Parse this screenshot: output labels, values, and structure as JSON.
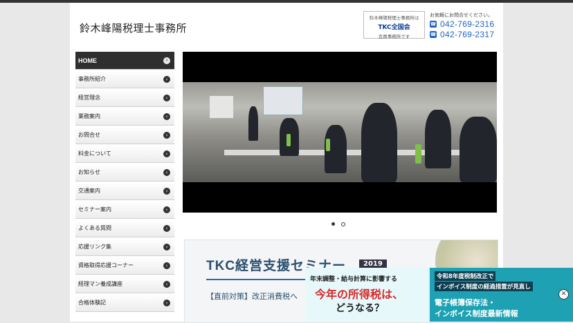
{
  "header": {
    "site_title": "鈴木峰陽税理士事務所",
    "tkc": {
      "line1": "鈴木峰陽税理士事務所は",
      "logo_text": "TKC全国会",
      "line3": "会員事務所です"
    },
    "contact": {
      "lead": "お気軽にお問合せください。",
      "tel1": "042-769-2316",
      "tel2": "042-769-2317"
    }
  },
  "nav": {
    "items": [
      {
        "label": "HOME"
      },
      {
        "label": "事務所紹介"
      },
      {
        "label": "経営理念"
      },
      {
        "label": "業務案内"
      },
      {
        "label": "お問合せ"
      },
      {
        "label": "料金について"
      },
      {
        "label": "お知らせ"
      },
      {
        "label": "交通案内"
      },
      {
        "label": "セミナー案内"
      },
      {
        "label": "よくある質問"
      },
      {
        "label": "応援リンク集"
      },
      {
        "label": "資格取得応援コーナー"
      },
      {
        "label": "経理マン養成講座"
      },
      {
        "label": "合格体験記"
      }
    ]
  },
  "banner": {
    "title": "TKC経営支援セミナー",
    "year": "2019",
    "subtitle": "【直前対策】改正消費税へ"
  },
  "ad": {
    "left_line1": "年末調整・給与計算に影響する",
    "left_line2": "今年の所得税は、",
    "left_line3": "どうなる？",
    "right_line1": "令和8年度税制改正で",
    "right_line2": "インボイス制度の経過措置が見直し",
    "right_line3": "電子帳簿保存法・",
    "right_line4": "インボイス制度最新情報",
    "close_label": "✕"
  },
  "colors": {
    "accent": "#1d63c3",
    "nav_active": "#2f2f2f",
    "ad_right": "#1ea2b3"
  }
}
